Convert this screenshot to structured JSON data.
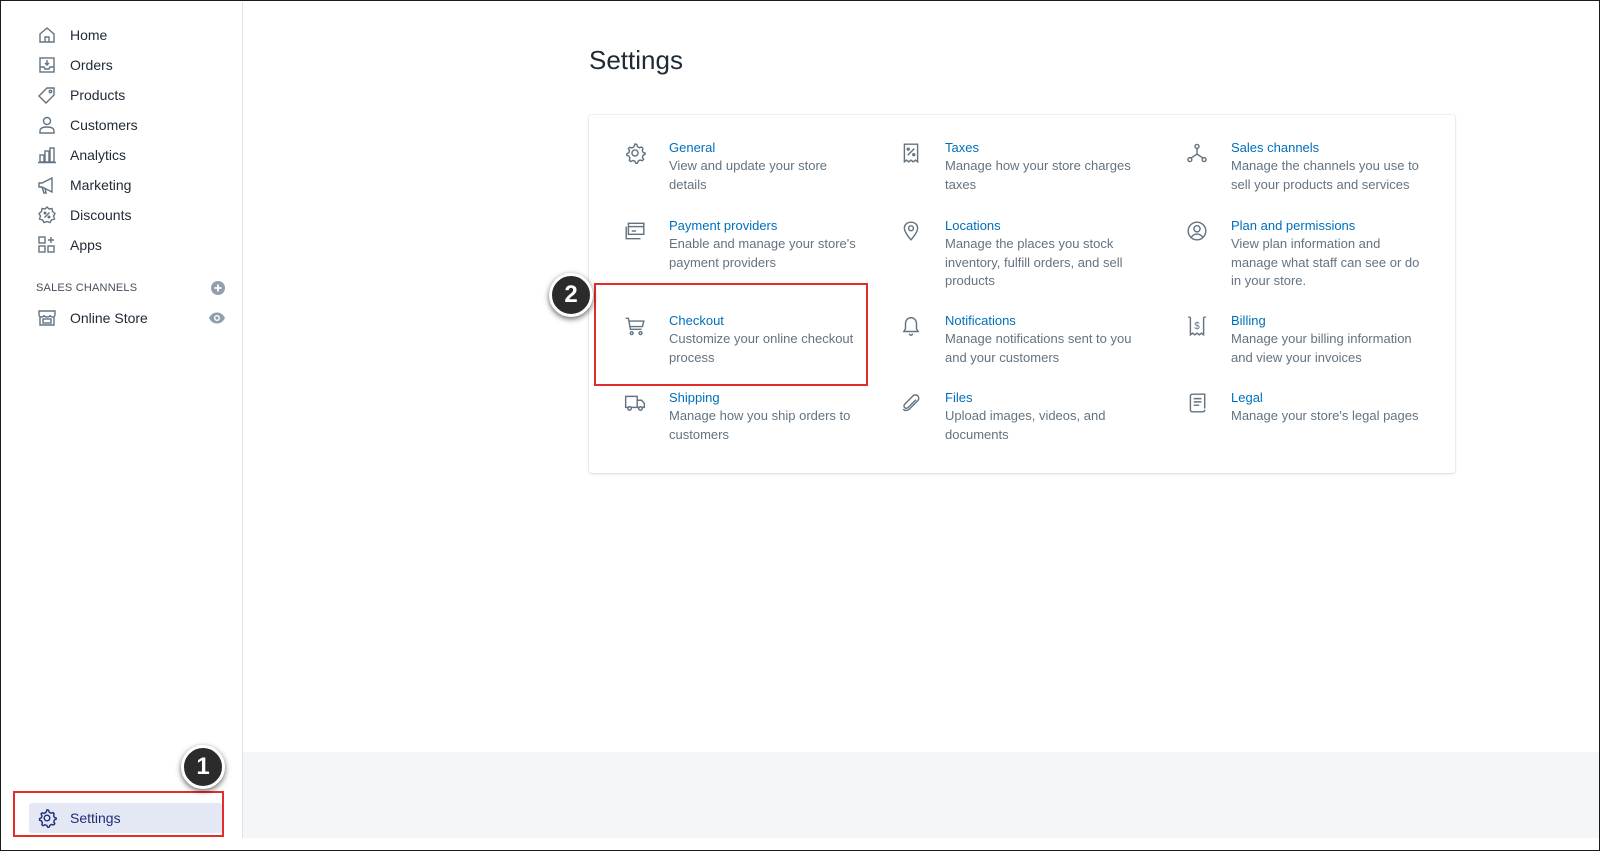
{
  "sidebar": {
    "items": [
      {
        "label": "Home",
        "icon": "home-icon"
      },
      {
        "label": "Orders",
        "icon": "orders-icon"
      },
      {
        "label": "Products",
        "icon": "tag-icon"
      },
      {
        "label": "Customers",
        "icon": "person-icon"
      },
      {
        "label": "Analytics",
        "icon": "bar-chart-icon"
      },
      {
        "label": "Marketing",
        "icon": "megaphone-icon"
      },
      {
        "label": "Discounts",
        "icon": "discount-icon"
      },
      {
        "label": "Apps",
        "icon": "apps-icon"
      }
    ],
    "sales_channels_header": "SALES CHANNELS",
    "online_store_label": "Online Store",
    "settings_label": "Settings"
  },
  "main": {
    "title": "Settings",
    "items": [
      {
        "title": "General",
        "description": "View and update your store details",
        "icon": "gear-icon"
      },
      {
        "title": "Taxes",
        "description": "Manage how your store charges taxes",
        "icon": "tax-icon"
      },
      {
        "title": "Sales channels",
        "description": "Manage the channels you use to sell your products and services",
        "icon": "sales-channels-icon"
      },
      {
        "title": "Payment providers",
        "description": "Enable and manage your store's payment providers",
        "icon": "payment-icon"
      },
      {
        "title": "Locations",
        "description": "Manage the places you stock inventory, fulfill orders, and sell products",
        "icon": "location-pin-icon"
      },
      {
        "title": "Plan and permissions",
        "description": "View plan information and manage what staff can see or do in your store.",
        "icon": "account-circle-icon"
      },
      {
        "title": "Checkout",
        "description": "Customize your online checkout process",
        "icon": "cart-icon"
      },
      {
        "title": "Notifications",
        "description": "Manage notifications sent to you and your customers",
        "icon": "bell-icon"
      },
      {
        "title": "Billing",
        "description": "Manage your billing information and view your invoices",
        "icon": "billing-icon"
      },
      {
        "title": "Shipping",
        "description": "Manage how you ship orders to customers",
        "icon": "truck-icon"
      },
      {
        "title": "Files",
        "description": "Upload images, videos, and documents",
        "icon": "paperclip-icon"
      },
      {
        "title": "Legal",
        "description": "Manage your store's legal pages",
        "icon": "legal-icon"
      }
    ]
  },
  "annotations": {
    "step1": "1",
    "step2": "2",
    "highlight_color": "#e32c2c"
  },
  "colors": {
    "link": "#006fbb",
    "settings_active_bg": "#e4e7f4",
    "settings_active_text": "#202e78"
  }
}
